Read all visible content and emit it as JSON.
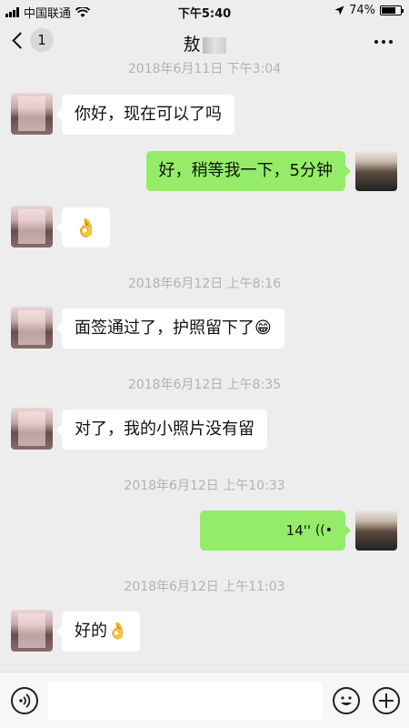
{
  "status_bar": {
    "carrier": "中国联通",
    "time": "下午5:40",
    "battery": "74%",
    "battery_level": 0.74
  },
  "nav": {
    "back_count": "1",
    "title": "敖"
  },
  "messages": [
    {
      "type": "timestamp",
      "text": "2018年6月11日 下午3:04"
    },
    {
      "type": "text",
      "side": "left",
      "text": "你好，现在可以了吗"
    },
    {
      "type": "text",
      "side": "right",
      "text": "好，稍等我一下，5分钟"
    },
    {
      "type": "emoji",
      "side": "left",
      "text": "👌"
    },
    {
      "type": "timestamp",
      "text": "2018年6月12日 上午8:16"
    },
    {
      "type": "text",
      "side": "left",
      "text": "面签通过了，护照留下了😁"
    },
    {
      "type": "timestamp",
      "text": "2018年6月12日 上午8:35"
    },
    {
      "type": "text",
      "side": "left",
      "text": "对了，我的小照片没有留"
    },
    {
      "type": "timestamp",
      "text": "2018年6月12日 上午10:33"
    },
    {
      "type": "voice",
      "side": "right",
      "text": "14''"
    },
    {
      "type": "timestamp",
      "text": "2018年6月12日 上午11:03"
    },
    {
      "type": "text",
      "side": "left",
      "text": "好的👌"
    }
  ],
  "icons": {
    "wifi": "wifi-icon",
    "location": "location-arrow-icon",
    "voice_toggle": "voice-icon",
    "emoji": "emoji-icon",
    "plus": "plus-icon"
  }
}
